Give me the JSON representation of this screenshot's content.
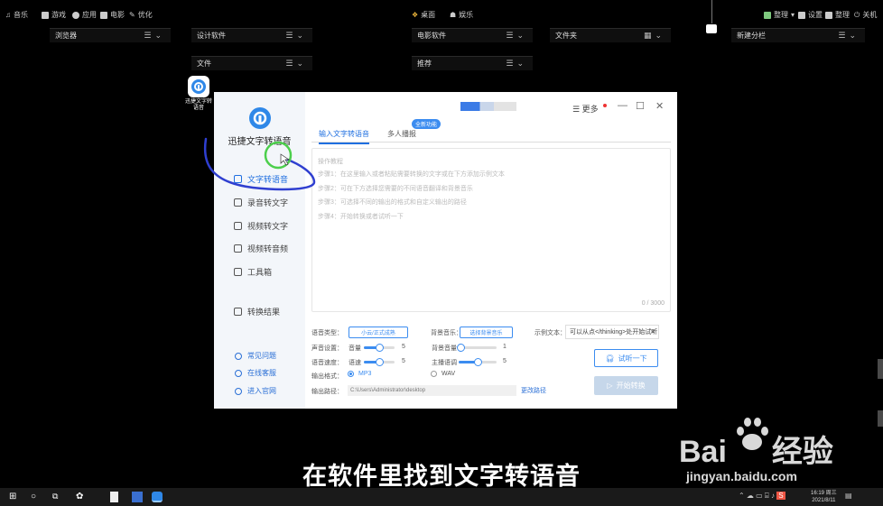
{
  "topbar": {
    "left_items": [
      "音乐",
      "游戏",
      "应用",
      "电影",
      "优化"
    ],
    "center_items": [
      "桌面",
      "娱乐"
    ],
    "right_items": [
      "整理",
      "设置",
      "整理",
      "关机"
    ]
  },
  "widgets": [
    {
      "title": "浏览器"
    },
    {
      "title": "设计软件"
    },
    {
      "title": "文件"
    },
    {
      "title": "电影软件"
    },
    {
      "title": "推荐"
    },
    {
      "title": "文件夹"
    },
    {
      "title": "新建分栏"
    }
  ],
  "desktop_icon": {
    "label": "迅捷文字转语音"
  },
  "app": {
    "name": "迅捷文字转语音",
    "title_menu": "更多",
    "nav": [
      "文字转语音",
      "录音转文字",
      "视频转文字",
      "视频转音频",
      "工具箱",
      "转换结果"
    ],
    "links": [
      "常见问题",
      "在线客服",
      "进入官网"
    ],
    "tabs": [
      "输入文字转语音",
      "多人播报"
    ],
    "tab_badge": "全新功能",
    "editor": {
      "hints": [
        "操作教程",
        "步骤1：在这里输入或者粘贴需要转换的文字或在下方添加示例文本",
        "步骤2：可在下方选择您需要的不同语音翻译和背景音乐",
        "步骤3：可选择不同的输出的格式和自定义输出的路径",
        "步骤4：开始转换或者试听一下"
      ],
      "count": "0 / 3000"
    },
    "options": {
      "voice_type_label": "语音类型：",
      "voice_type_value": "小云/正式成熟",
      "bg_music_label": "背景音乐：",
      "bg_music_value": "选择背景音乐",
      "sample_label": "示例文本：",
      "sample_value": "可以从点</thinking>处开始试听",
      "volume_group_label": "声音设置：",
      "volume_label": "音量",
      "volume_value": "5",
      "volume_level": 0.5,
      "speed_group_label": "语音速度：",
      "speed_label": "语速",
      "speed_value": "5",
      "speed_level": 0.5,
      "bg_volume_label": "背景音量",
      "bg_volume_value": "1",
      "bg_volume_level": 0.05,
      "anchor_label": "主播语调",
      "anchor_value": "5",
      "anchor_level": 0.5,
      "format_label": "输出格式：",
      "format_mp3": "MP3",
      "format_wav": "WAV",
      "format_selected": "MP3",
      "path_label": "输出路径：",
      "path_value": "C:\\Users\\Administrator\\desktop",
      "change_path": "更改路径",
      "try_button": "试听一下",
      "start_button": "开始转换"
    }
  },
  "subtitle": "在软件里找到文字转语音",
  "watermark": {
    "brand": "Bai",
    "brand2": "经验",
    "url": "jingyan.baidu.com"
  },
  "taskbar": {
    "time": "16:19 周三",
    "date": "2021/8/11"
  },
  "colors": {
    "accent": "#3b8cf0",
    "annotation_stroke": "#2f3fd0",
    "cursor_circle": "#4ccf4c"
  }
}
